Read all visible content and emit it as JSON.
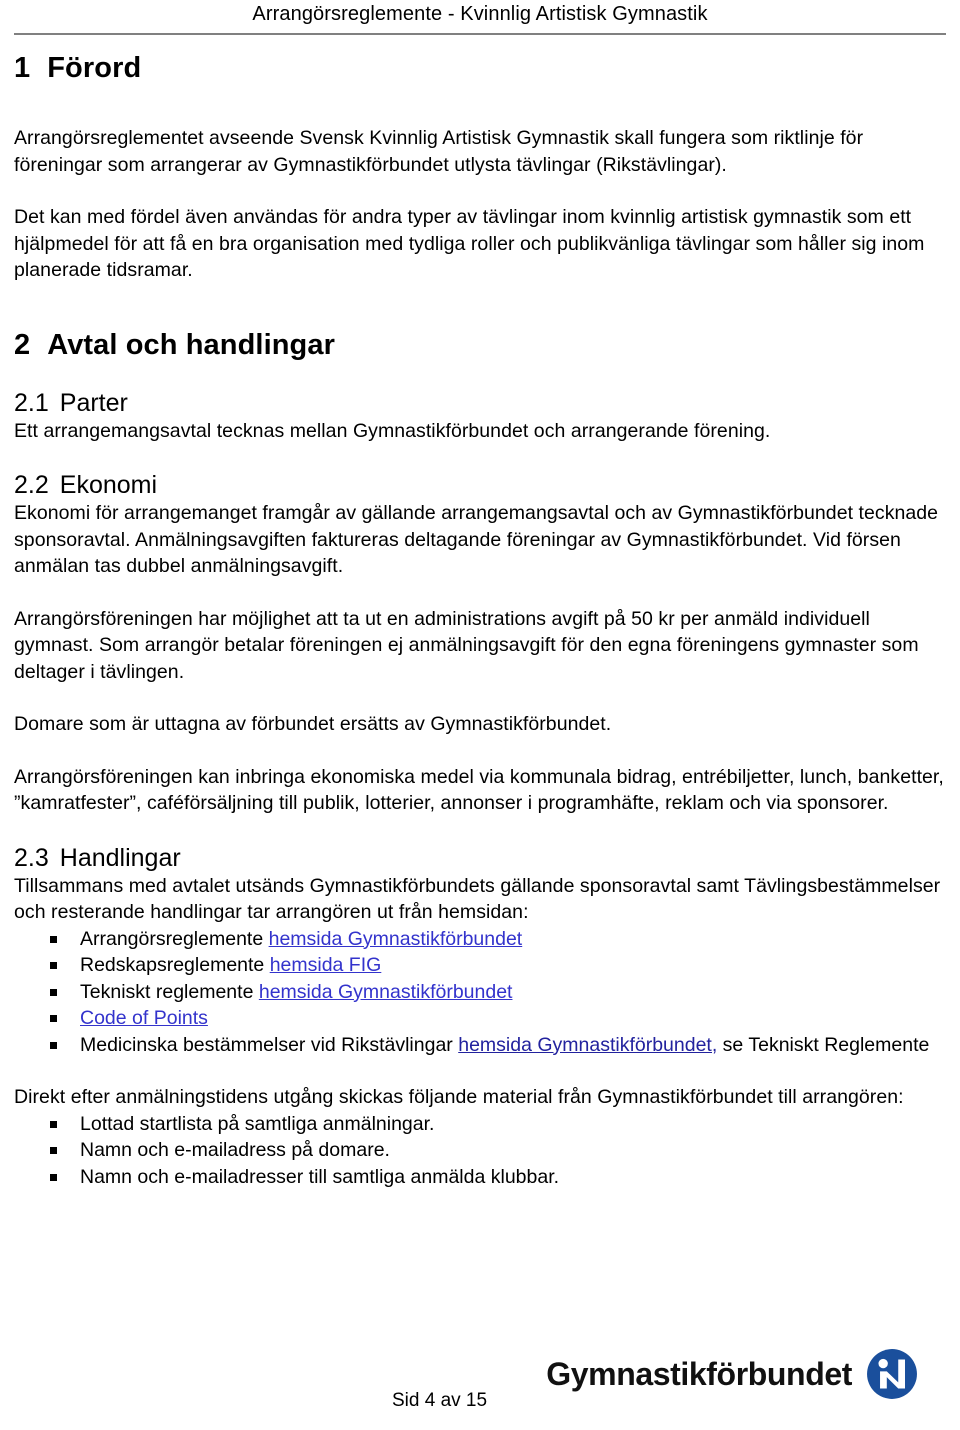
{
  "header": {
    "running_title": "Arrangörsreglemente - Kvinnlig Artistisk Gymnastik"
  },
  "sections": [
    {
      "number": "1",
      "title": "Förord",
      "paragraphs": [
        "Arrangörsreglementet avseende Svensk Kvinnlig Artistisk Gymnastik skall fungera som riktlinje för föreningar som arrangerar av Gymnastikförbundet utlysta tävlingar (Rikstävlingar).",
        "Det kan med fördel även användas för andra typer av tävlingar inom kvinnlig artistisk gymnastik som ett hjälpmedel för att få en bra organisation med tydliga roller och publikvänliga tävlingar som håller sig inom planerade tidsramar."
      ]
    },
    {
      "number": "2",
      "title": "Avtal och handlingar",
      "subsections": [
        {
          "number": "2.1",
          "title": "Parter",
          "paragraphs": [
            "Ett arrangemangsavtal tecknas mellan Gymnastikförbundet och arrangerande förening."
          ]
        },
        {
          "number": "2.2",
          "title": "Ekonomi",
          "paragraphs": [
            "Ekonomi för arrangemanget framgår av gällande arrangemangsavtal och av Gymnastikförbundet tecknade sponsoravtal. Anmälningsavgiften faktureras deltagande föreningar av Gymnastikförbundet. Vid försen anmälan tas dubbel anmälningsavgift.",
            "Arrangörsföreningen har möjlighet att ta ut en administrations avgift på 50 kr per anmäld individuell gymnast. Som arrangör betalar föreningen ej anmälningsavgift för den egna föreningens gymnaster som deltager i tävlingen.",
            "Domare som är uttagna av förbundet ersätts av Gymnastikförbundet.",
            "Arrangörsföreningen kan inbringa ekonomiska medel via kommunala bidrag, entrébiljetter, lunch, banketter, ”kamratfester”, caféförsäljning till publik, lotterier, annonser i programhäfte, reklam och via sponsorer."
          ]
        },
        {
          "number": "2.3",
          "title": "Handlingar",
          "intro": "Tillsammans med avtalet utsänds Gymnastikförbundets gällande sponsoravtal samt Tävlingsbestämmelser och resterande handlingar tar arrangören ut från hemsidan:",
          "list": [
            {
              "text_before": "Arrangörsreglemente ",
              "link": "hemsida Gymnastikförbundet",
              "text_after": ""
            },
            {
              "text_before": "Redskapsreglemente ",
              "link": "hemsida FIG",
              "text_after": ""
            },
            {
              "text_before": "Tekniskt reglemente ",
              "link": "hemsida Gymnastikförbundet",
              "text_after": ""
            },
            {
              "text_before": "",
              "link": "Code of Points",
              "text_after": ""
            },
            {
              "text_before": "Medicinska bestämmelser vid Rikstävlingar ",
              "link": "hemsida Gymnastikförbundet,",
              "text_after": " se Tekniskt Reglemente"
            }
          ],
          "outro_intro": "Direkt efter anmälningstidens utgång skickas följande material från Gymnastikförbundet till arrangören:",
          "outro_list": [
            "Lottad startlista på samtliga anmälningar.",
            "Namn och e-mailadress på domare.",
            "Namn och e-mailadresser till samtliga anmälda klubbar."
          ]
        }
      ]
    }
  ],
  "footer": {
    "page_label": "Sid 4 av 15",
    "brand_name": "Gymnastikförbundet",
    "brand_logo_icon": "gymnastikforbundet-logo-icon"
  },
  "colors": {
    "link": "#3333cc",
    "link_dark": "#22229e",
    "rule": "#808080",
    "brand_blue": "#1a4f9c",
    "text": "#000000"
  }
}
